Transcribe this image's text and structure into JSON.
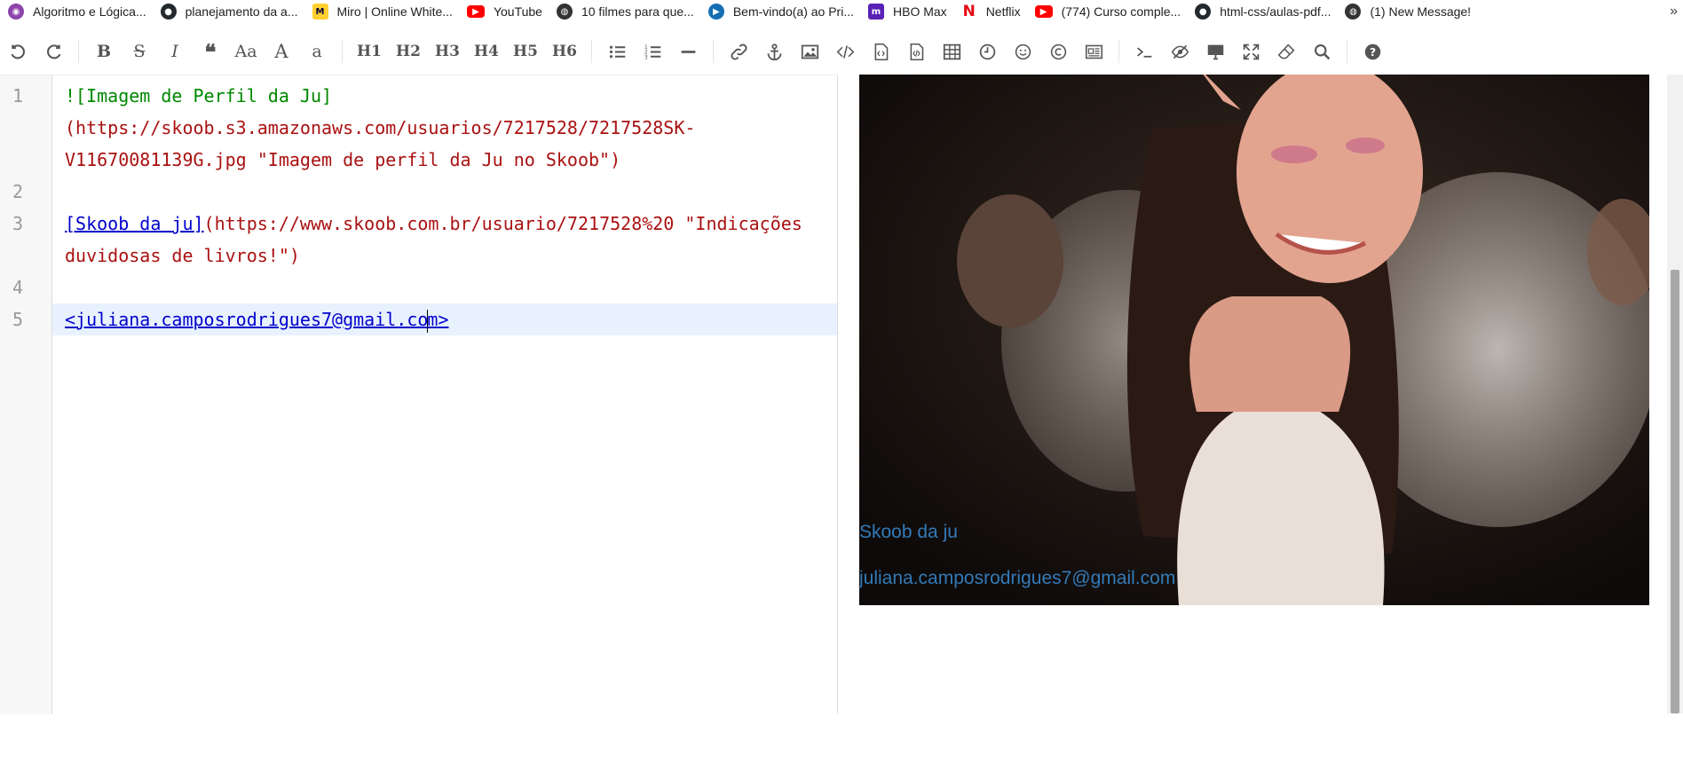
{
  "bookmarks": [
    {
      "label": "Algoritmo e Lógica...",
      "icon": "bonsai-logo-icon",
      "color": "#8e44ad"
    },
    {
      "label": "planejamento da a...",
      "icon": "github-icon",
      "color": "#24292e"
    },
    {
      "label": "Miro | Online White...",
      "icon": "miro-icon",
      "color": "#ffd02f"
    },
    {
      "label": "YouTube",
      "icon": "youtube-icon",
      "color": "#ff0000"
    },
    {
      "label": "10 filmes para que...",
      "icon": "globe-icon",
      "color": "#333333"
    },
    {
      "label": "Bem-vindo(a) ao Pri...",
      "icon": "prime-video-icon",
      "color": "#146eb4"
    },
    {
      "label": "HBO Max",
      "icon": "hbo-max-icon",
      "color": "#5822b4"
    },
    {
      "label": "Netflix",
      "icon": "netflix-icon",
      "color": "#e50914"
    },
    {
      "label": "(774) Curso comple...",
      "icon": "youtube-icon",
      "color": "#ff0000"
    },
    {
      "label": "html-css/aulas-pdf...",
      "icon": "github-icon",
      "color": "#24292e"
    },
    {
      "label": "(1) New Message!",
      "icon": "globe-icon",
      "color": "#333333"
    }
  ],
  "bookmarks_more": "»",
  "toolbar": {
    "bold": "B",
    "strike": "S",
    "italic": "I",
    "quote": "❝",
    "case": "Aa",
    "upper": "A",
    "lower": "a",
    "h1": "H1",
    "h2": "H2",
    "h3": "H3",
    "h4": "H4",
    "h5": "H5",
    "h6": "H6"
  },
  "editor": {
    "line_numbers": [
      "1",
      "2",
      "3",
      "4",
      "5"
    ],
    "line1a": "![Imagem de Perfil da Ju]",
    "line1b": "(https://skoob.s3.amazonaws.com/usuarios/7217528/7217528SK-",
    "line1c": "V11670081139G.jpg \"Imagem de perfil da Ju no Skoob\")",
    "line3_link": "[Skoob da ju]",
    "line3a": "(https://www.skoob.com.br/usuario/7217528%20 \"Indicações",
    "line3b": "duvidosas de livros!\")",
    "line5a": "<juliana.camposrodrigues7@gmail.co",
    "line5b": "m>"
  },
  "preview": {
    "link1": "Skoob da ju",
    "link2": "juliana.camposrodrigues7@gmail.com"
  },
  "colors": {
    "link": "#337ab7",
    "md_image": "#008800",
    "md_url": "#aa1111",
    "md_link": "#0000cc",
    "active_line": "#e8f2ff"
  }
}
